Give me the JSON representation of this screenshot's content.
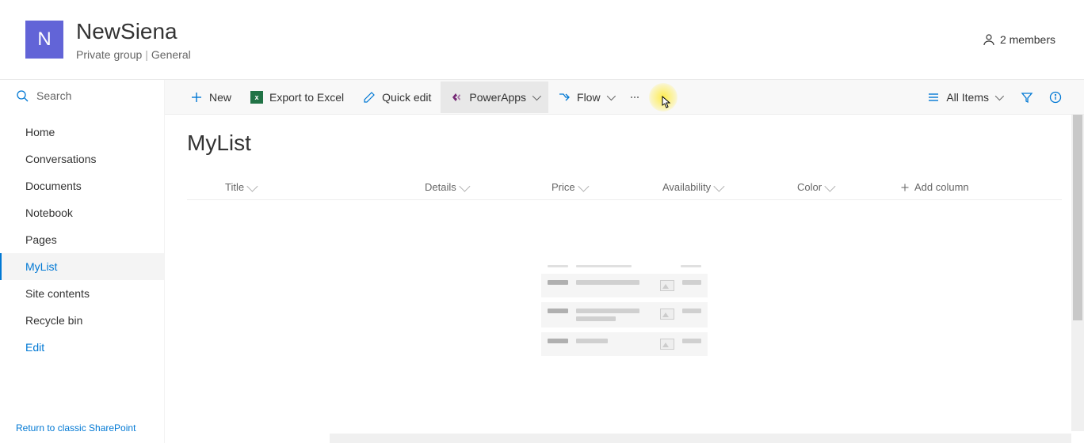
{
  "header": {
    "logo_letter": "N",
    "title": "NewSiena",
    "subtitle_left": "Private group",
    "subtitle_right": "General",
    "members_label": "2 members"
  },
  "search": {
    "placeholder": "Search"
  },
  "nav": {
    "items": [
      {
        "label": "Home",
        "active": false
      },
      {
        "label": "Conversations",
        "active": false
      },
      {
        "label": "Documents",
        "active": false
      },
      {
        "label": "Notebook",
        "active": false
      },
      {
        "label": "Pages",
        "active": false
      },
      {
        "label": "MyList",
        "active": true
      },
      {
        "label": "Site contents",
        "active": false
      },
      {
        "label": "Recycle bin",
        "active": false
      },
      {
        "label": "Edit",
        "active": false,
        "link": true
      }
    ],
    "footer": "Return to classic SharePoint"
  },
  "commands": {
    "new": "New",
    "export": "Export to Excel",
    "quickedit": "Quick edit",
    "powerapps": "PowerApps",
    "flow": "Flow",
    "allitems": "All Items"
  },
  "list": {
    "title": "MyList",
    "columns": {
      "title": "Title",
      "details": "Details",
      "price": "Price",
      "availability": "Availability",
      "color": "Color",
      "add": "Add column"
    }
  }
}
